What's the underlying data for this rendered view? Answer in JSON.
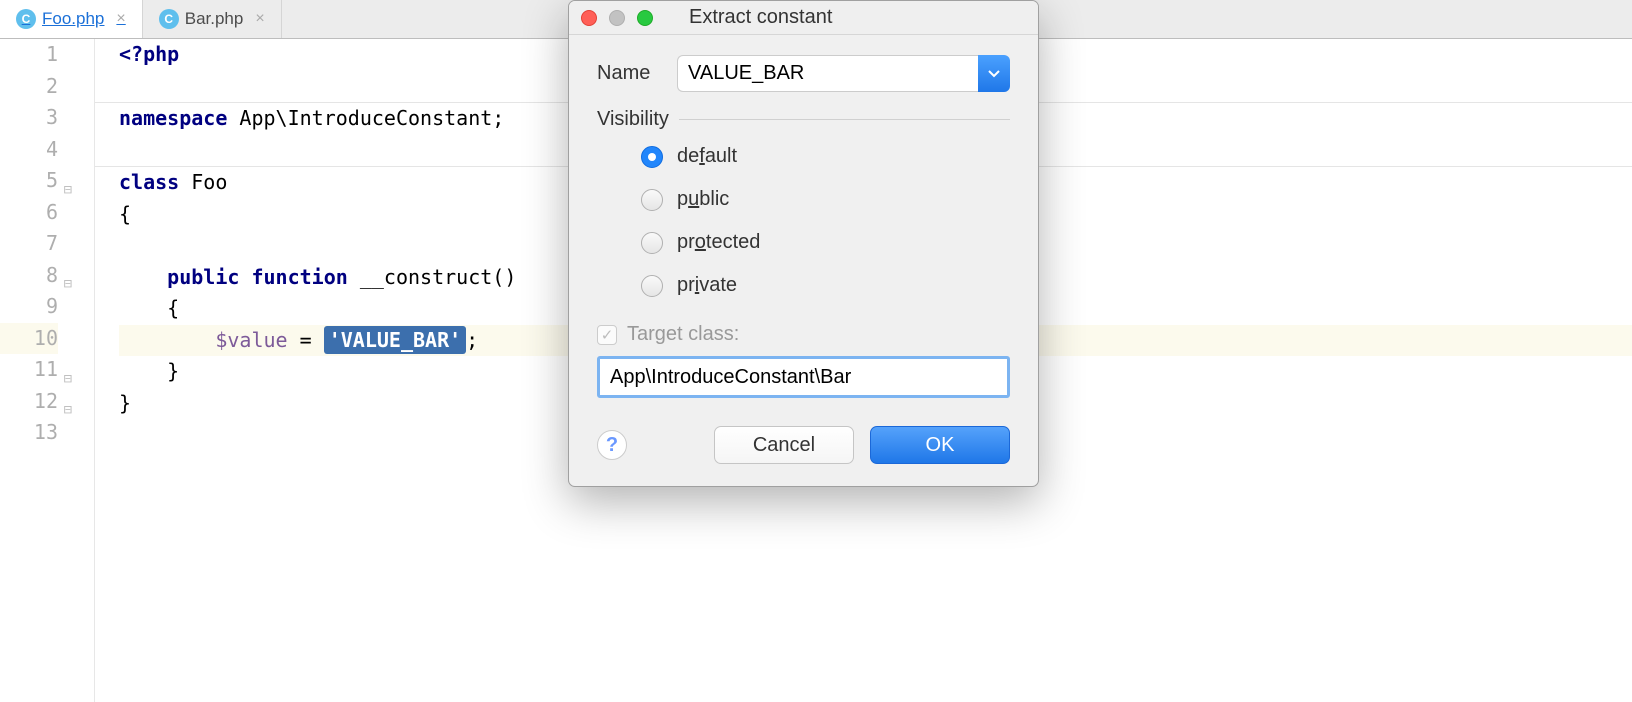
{
  "tabs": [
    {
      "label": "Foo.php",
      "active": true
    },
    {
      "label": "Bar.php",
      "active": false
    }
  ],
  "line_numbers": [
    "1",
    "2",
    "3",
    "4",
    "5",
    "6",
    "7",
    "8",
    "9",
    "10",
    "11",
    "12",
    "13"
  ],
  "highlighted_line": 10,
  "code": {
    "l1_open": "<?php",
    "l3_ns": "namespace",
    "l3_path": " App\\IntroduceConstant;",
    "l5_class": "class",
    "l5_name": " Foo",
    "l6": "{",
    "l8_public": "public",
    "l8_function": "function",
    "l8_name": " __construct()",
    "l9": "    {",
    "l10_var": "$value",
    "l10_eq": " = ",
    "l10_str": "'VALUE_BAR'",
    "l10_semi": ";",
    "l11": "    }",
    "l12": "}"
  },
  "dialog": {
    "title": "Extract constant",
    "name_label": "Name",
    "name_value": "VALUE_BAR",
    "visibility_label": "Visibility",
    "visibility_options": {
      "default_pre": "de",
      "default_u": "f",
      "default_post": "ault",
      "public_pre": "p",
      "public_u": "u",
      "public_post": "blic",
      "protected_pre": "pr",
      "protected_u": "o",
      "protected_post": "tected",
      "private_pre": "pr",
      "private_u": "i",
      "private_post": "vate"
    },
    "target_label": "Target class:",
    "target_value": "App\\IntroduceConstant\\Bar",
    "cancel": "Cancel",
    "ok": "OK",
    "help": "?"
  }
}
